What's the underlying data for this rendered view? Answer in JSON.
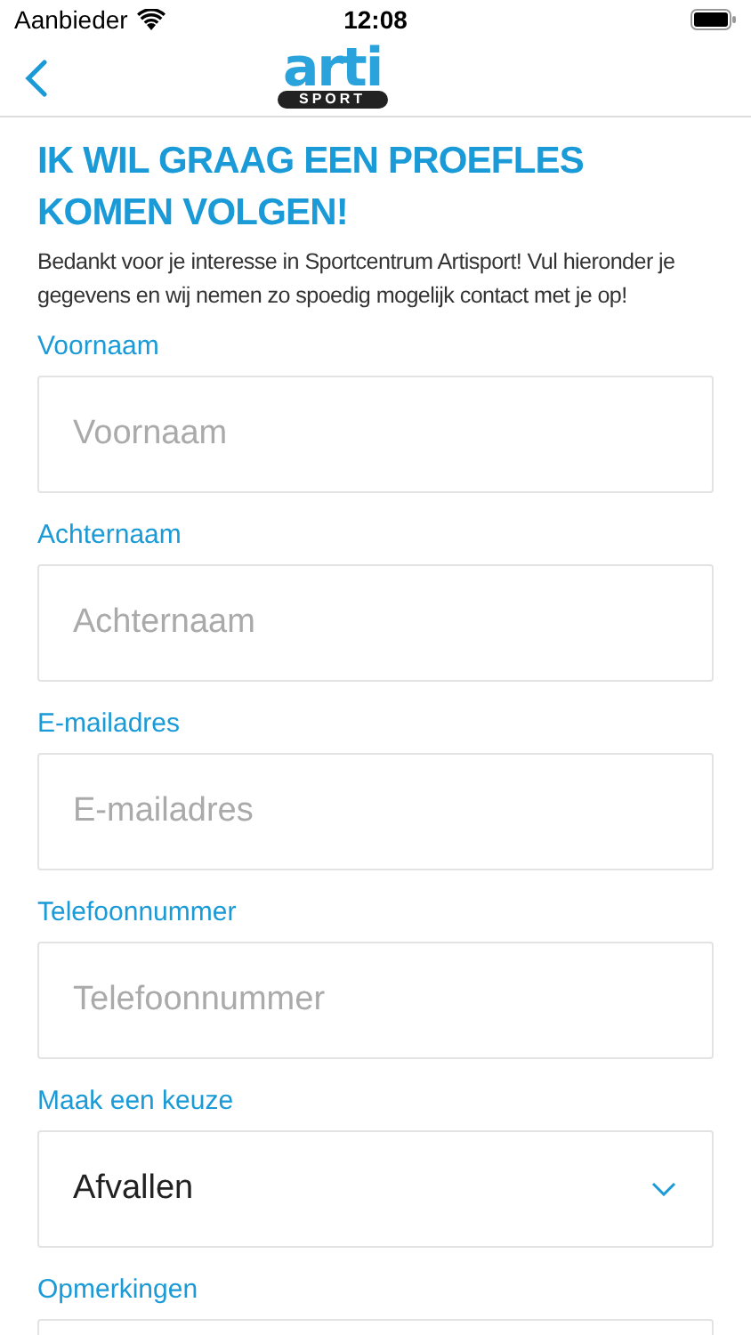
{
  "status_bar": {
    "carrier": "Aanbieder",
    "time": "12:08"
  },
  "header": {
    "logo_top": "arti",
    "logo_bottom": "SPORT"
  },
  "title": "IK WIL GRAAG EEN PROEFLES KOMEN VOLGEN!",
  "intro": "Bedankt voor je interesse in Sportcentrum Artisport! Vul hieronder je gegevens en wij nemen zo spoedig mogelijk contact met je op!",
  "fields": [
    {
      "kind": "text",
      "label": "Voornaam",
      "placeholder": "Voornaam"
    },
    {
      "kind": "text",
      "label": "Achternaam",
      "placeholder": "Achternaam"
    },
    {
      "kind": "text",
      "label": "E-mailadres",
      "placeholder": "E-mailadres"
    },
    {
      "kind": "text",
      "label": "Telefoonnummer",
      "placeholder": "Telefoonnummer"
    },
    {
      "kind": "select",
      "label": "Maak een keuze",
      "value": "Afvallen"
    },
    {
      "kind": "textarea",
      "label": "Opmerkingen"
    }
  ]
}
